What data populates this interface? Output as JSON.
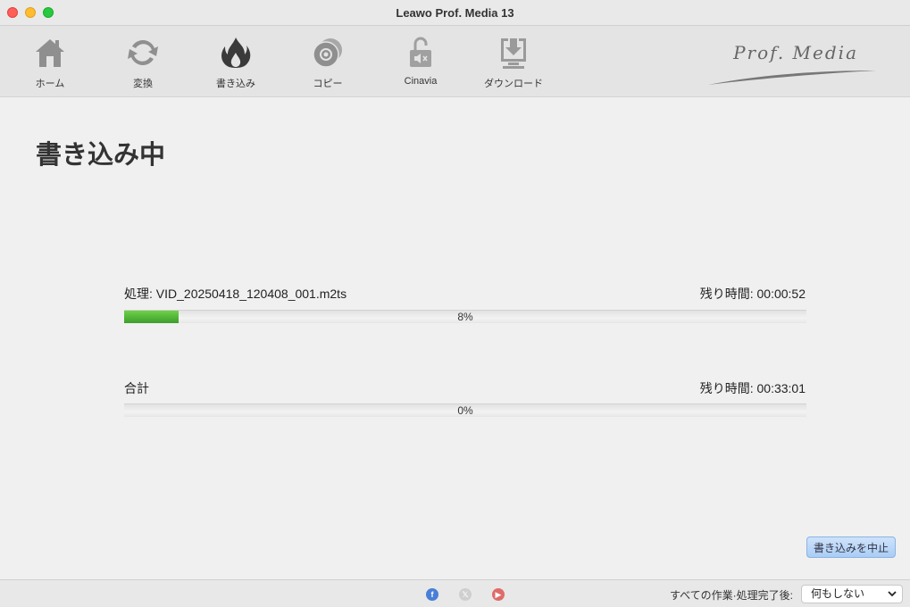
{
  "window": {
    "title": "Leawo Prof. Media 13"
  },
  "toolbar": {
    "items": [
      {
        "label": "ホーム",
        "icon": "home-icon"
      },
      {
        "label": "変換",
        "icon": "convert-icon"
      },
      {
        "label": "書き込み",
        "icon": "burn-icon"
      },
      {
        "label": "コピー",
        "icon": "copy-disc-icon"
      },
      {
        "label": "Cinavia",
        "icon": "cinavia-unlock-icon"
      },
      {
        "label": "ダウンロード",
        "icon": "download-icon"
      }
    ],
    "brand": "Prof. Media"
  },
  "main": {
    "heading": "書き込み中",
    "current": {
      "label": "処理:",
      "file": "VID_20250418_120408_001.m2ts",
      "remaining_label": "残り時間:",
      "remaining": "00:00:52",
      "progress_percent": 8,
      "progress_text": "8%"
    },
    "total": {
      "label": "合計",
      "remaining_label": "残り時間:",
      "remaining": "00:33:01",
      "progress_percent": 0,
      "progress_text": "0%"
    },
    "stop_button": "書き込みを中止"
  },
  "statusbar": {
    "social": [
      {
        "name": "facebook",
        "glyph": "f",
        "color": "#4a7fd6"
      },
      {
        "name": "x",
        "glyph": "𝕏",
        "color": "#cfcfcf"
      },
      {
        "name": "youtube",
        "glyph": "▶",
        "color": "#e06a6a"
      }
    ],
    "after_label": "すべての作業·処理完了後:",
    "after_value": "何もしない"
  }
}
